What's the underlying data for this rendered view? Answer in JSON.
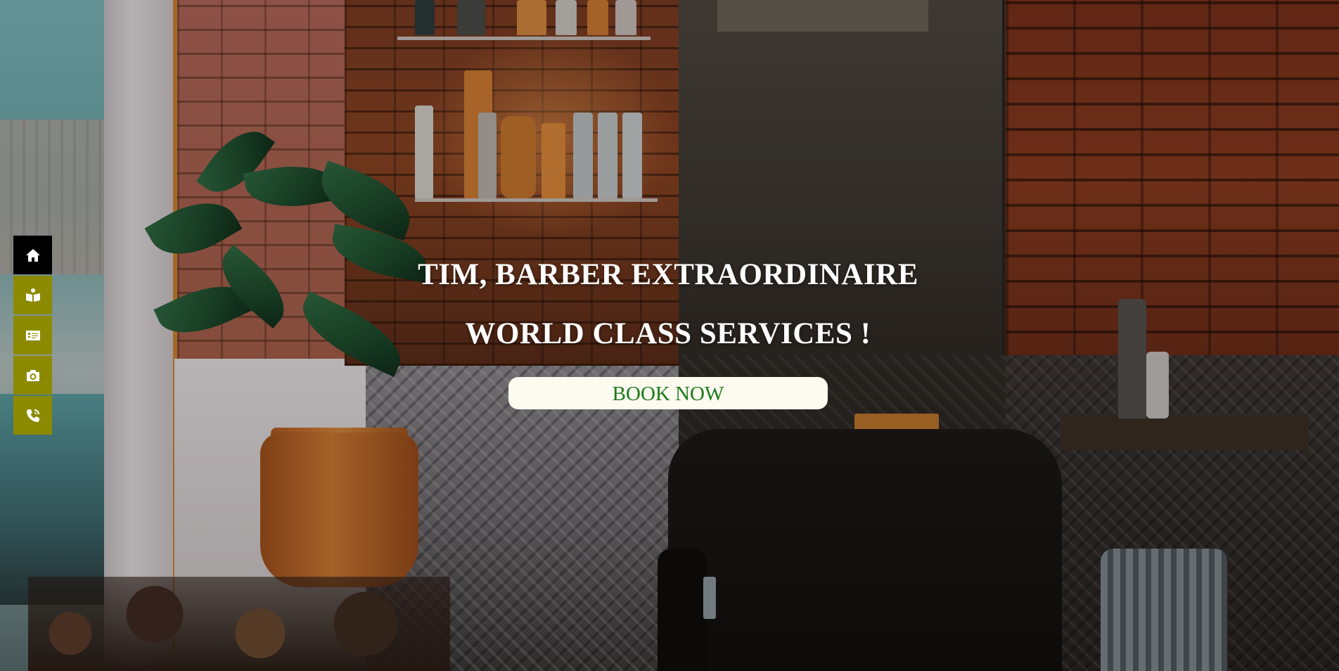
{
  "nav": {
    "items": [
      {
        "icon": "home-icon",
        "active": true
      },
      {
        "icon": "book-open-icon",
        "active": false
      },
      {
        "icon": "price-card-icon",
        "active": false
      },
      {
        "icon": "camera-icon",
        "active": false
      },
      {
        "icon": "phone-icon",
        "active": false
      }
    ],
    "active_color": "#000000",
    "color": "#8b8a00"
  },
  "hero": {
    "title": "TIM, BARBER EXTRAORDINAIRE",
    "subtitle": "WORLD CLASS SERVICES !",
    "cta_label": "BOOK NOW",
    "cta_text_color": "#1b7a1b",
    "cta_bg_color": "#fdfaf0"
  }
}
